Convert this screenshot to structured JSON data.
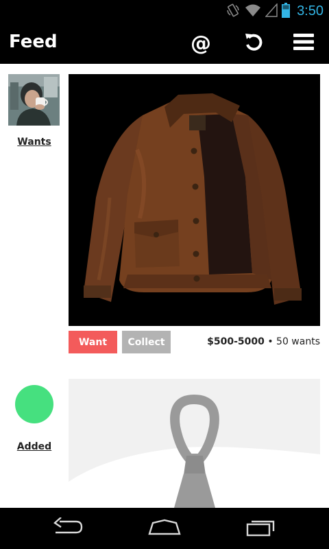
{
  "status_bar": {
    "time": "3:50",
    "icons": [
      "vibrate-icon",
      "wifi-icon",
      "signal-icon",
      "battery-icon"
    ],
    "accent_color": "#33b5e5"
  },
  "action_bar": {
    "title": "Feed",
    "actions": [
      {
        "name": "mentions",
        "label": "@"
      },
      {
        "name": "refresh",
        "icon": "refresh-icon"
      },
      {
        "name": "menu",
        "icon": "menu-icon"
      }
    ]
  },
  "feed": {
    "items": [
      {
        "activity": "Wants",
        "avatar": "user-avatar-drinking-mug",
        "image": "brown-leather-jacket",
        "buttons": {
          "want": "Want",
          "collect": "Collect"
        },
        "price": "$500-5000",
        "separator": "•",
        "wants": "50 wants",
        "colors": {
          "want": "#f35b5b",
          "collect": "#b3b3b3"
        }
      },
      {
        "activity": "Added",
        "avatar_color": "#46e07f",
        "image": "grey-knit-tie"
      }
    ]
  },
  "nav_bar": {
    "buttons": [
      "back-icon",
      "home-icon",
      "recent-apps-icon"
    ]
  }
}
